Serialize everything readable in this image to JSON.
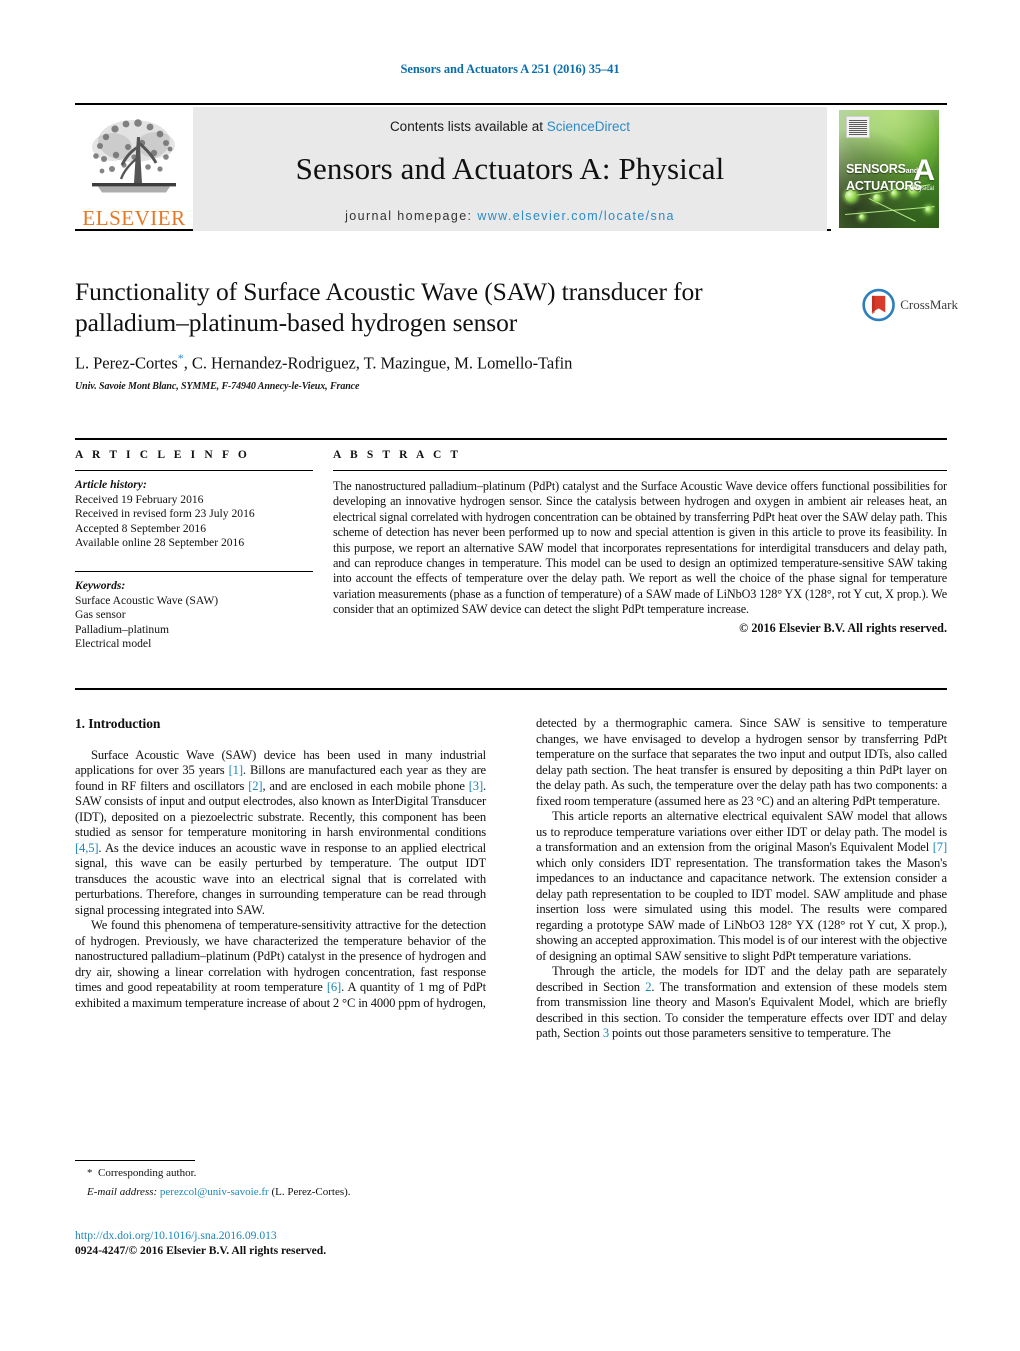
{
  "running_head": "Sensors and Actuators A 251 (2016) 35–41",
  "masthead": {
    "contents_prefix": "Contents lists available at ",
    "sciencedirect": "ScienceDirect",
    "journal_title": "Sensors and Actuators A: Physical",
    "homepage_prefix": "journal homepage: ",
    "homepage_url": "www.elsevier.com/locate/sna",
    "publisher_logo_text": "ELSEVIER",
    "cover": {
      "line1": "SENSORS",
      "line1_small": "and",
      "line2": "ACTUATORS",
      "letter": "A",
      "subtitle": "Physical"
    },
    "accent_color": "#2b8bc6",
    "elsevier_orange": "#e87722"
  },
  "article": {
    "title": "Functionality of Surface Acoustic Wave (SAW) transducer for palladium–platinum-based hydrogen sensor",
    "authors_pre": "L. Perez-Cortes",
    "authors_post": ", C. Hernandez-Rodriguez, T. Mazingue, M. Lomello-Tafin",
    "corresponding_marker": "*",
    "affiliation": "Univ. Savoie Mont Blanc, SYMME, F-74940 Annecy-le-Vieux, France",
    "crossmark_label": "CrossMark"
  },
  "info": {
    "heading": "A R T I C L E   I N F O",
    "history_label": "Article history:",
    "history": [
      "Received 19 February 2016",
      "Received in revised form 23 July 2016",
      "Accepted 8 September 2016",
      "Available online 28 September 2016"
    ],
    "keywords_label": "Keywords:",
    "keywords": [
      "Surface Acoustic Wave (SAW)",
      "Gas sensor",
      "Palladium–platinum",
      "Electrical model"
    ]
  },
  "abstract": {
    "heading": "A B S T R A C T",
    "text": "The nanostructured palladium–platinum (PdPt) catalyst and the Surface Acoustic Wave device offers functional possibilities for developing an innovative hydrogen sensor. Since the catalysis between hydrogen and oxygen in ambient air releases heat, an electrical signal correlated with hydrogen concentration can be obtained by transferring PdPt heat over the SAW delay path. This scheme of detection has never been performed up to now and special attention is given in this article to prove its feasibility. In this purpose, we report an alternative SAW model that incorporates representations for interdigital transducers and delay path, and can reproduce changes in temperature. This model can be used to design an optimized temperature-sensitive SAW taking into account the effects of temperature over the delay path. We report as well the choice of the phase signal for temperature variation measurements (phase as a function of temperature) of a SAW made of LiNbO3 128° YX (128°, rot Y cut, X prop.). We consider that an optimized SAW device can detect the slight PdPt temperature increase.",
    "copyright": "© 2016 Elsevier B.V. All rights reserved."
  },
  "sections": {
    "intro_heading": "1.  Introduction",
    "left": {
      "p1_a": "Surface Acoustic Wave (SAW) device has been used in many industrial applications for over 35 years ",
      "p1_ref1": "[1]",
      "p1_b": ". Billons are manufactured each year as they are found in RF filters and oscillators ",
      "p1_ref2": "[2]",
      "p1_c": ", and are enclosed in each mobile phone ",
      "p1_ref3": "[3]",
      "p1_d": ". SAW consists of input and output electrodes, also known as InterDigital Transducer (IDT), deposited on a piezoelectric substrate. Recently, this component has been studied as sensor for temperature monitoring in harsh environmental conditions ",
      "p1_ref4": "[4,5]",
      "p1_e": ". As the device induces an acoustic wave in response to an applied electrical signal, this wave can be easily perturbed by temperature. The output IDT transduces the acoustic wave into an electrical signal that is correlated with perturbations. Therefore, changes in surrounding temperature can be read through signal processing integrated into SAW.",
      "p2_a": "We found this phenomena of temperature-sensitivity attractive for the detection of hydrogen. Previously, we have characterized the temperature behavior of the nanostructured palladium–platinum (PdPt) catalyst in the presence of hydrogen and dry air, showing a linear correlation with hydrogen concentration, fast response times and good repeatability at room temperature ",
      "p2_ref": "[6]",
      "p2_b": ". A quantity of 1 mg of PdPt exhibited a maximum temperature increase of about 2 °C in 4000 ppm of hydrogen,"
    },
    "right": {
      "p1": "detected by a thermographic camera. Since SAW is sensitive to temperature changes, we have envisaged to develop a hydrogen sensor by transferring PdPt temperature on the surface that separates the two input and output IDTs, also called delay path section. The heat transfer is ensured by depositing a thin PdPt layer on the delay path. As such, the temperature over the delay path has two components: a fixed room temperature (assumed here as 23 °C) and an altering PdPt temperature.",
      "p2_a": "This article reports an alternative electrical equivalent SAW model that allows us to reproduce temperature variations over either IDT or delay path. The model is a transformation and an extension from the original Mason's Equivalent Model ",
      "p2_ref": "[7]",
      "p2_b": " which only considers IDT representation. The transformation takes the Mason's impedances to an inductance and capacitance network. The extension consider a delay path representation to be coupled to IDT model. SAW amplitude and phase insertion loss were simulated using this model. The results were compared regarding a prototype SAW made of LiNbO3 128° YX (128° rot Y cut, X prop.), showing an accepted approximation. This model is of our interest with the objective of designing an optimal SAW sensitive to slight PdPt temperature variations.",
      "p3_a": "Through the article, the models for IDT and the delay path are separately described in Section ",
      "p3_ref1": "2",
      "p3_b": ". The transformation and extension of these models stem from transmission line theory and Mason's Equivalent Model, which are briefly described in this section. To consider the temperature effects over IDT and delay path, Section ",
      "p3_ref2": "3",
      "p3_c": " points out those parameters sensitive to temperature. The"
    }
  },
  "footnote": {
    "star": "*",
    "corresponding": "Corresponding author.",
    "email_label": "E-mail address:",
    "email": "perezcol@univ-savoie.fr",
    "email_owner": "(L. Perez-Cortes).",
    "doi_url": "http://dx.doi.org/10.1016/j.sna.2016.09.013",
    "issn_line": "0924-4247/© 2016 Elsevier B.V. All rights reserved."
  }
}
